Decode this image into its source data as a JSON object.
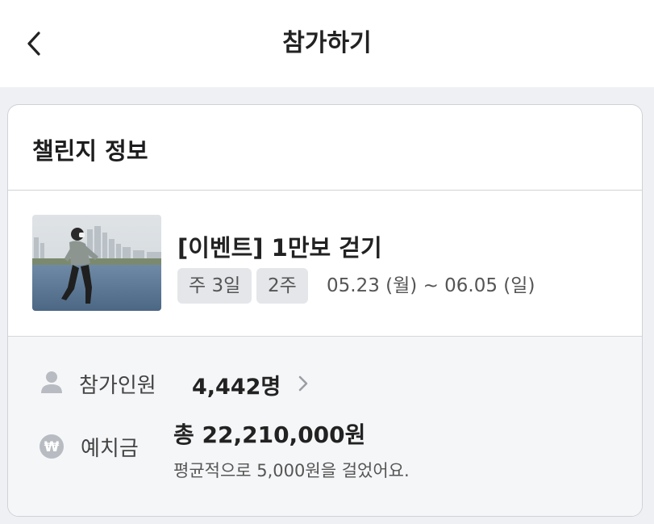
{
  "header": {
    "title": "참가하기",
    "back_icon": "chevron-left-icon"
  },
  "challenge_info": {
    "section_title": "챌린지 정보",
    "title": "[이벤트] 1만보 걷기",
    "frequency_chip": "주 3일",
    "duration_chip": "2주",
    "period": "05.23 (월) ~ 06.05 (일)"
  },
  "stats": {
    "participants": {
      "icon": "person-icon",
      "label": "참가인원",
      "value": "4,442명",
      "arrow_icon": "chevron-right-icon"
    },
    "deposit": {
      "icon": "won-coin-icon",
      "label": "예치금",
      "total": "총 22,210,000원",
      "average_note": "평균적으로 5,000원을 걸었어요."
    }
  },
  "colors": {
    "background": "#eef0f3",
    "card": "#ffffff",
    "stats_background": "#f5f6f8",
    "chip": "#e4e6e9",
    "icon_gray": "#b8bcc2"
  }
}
